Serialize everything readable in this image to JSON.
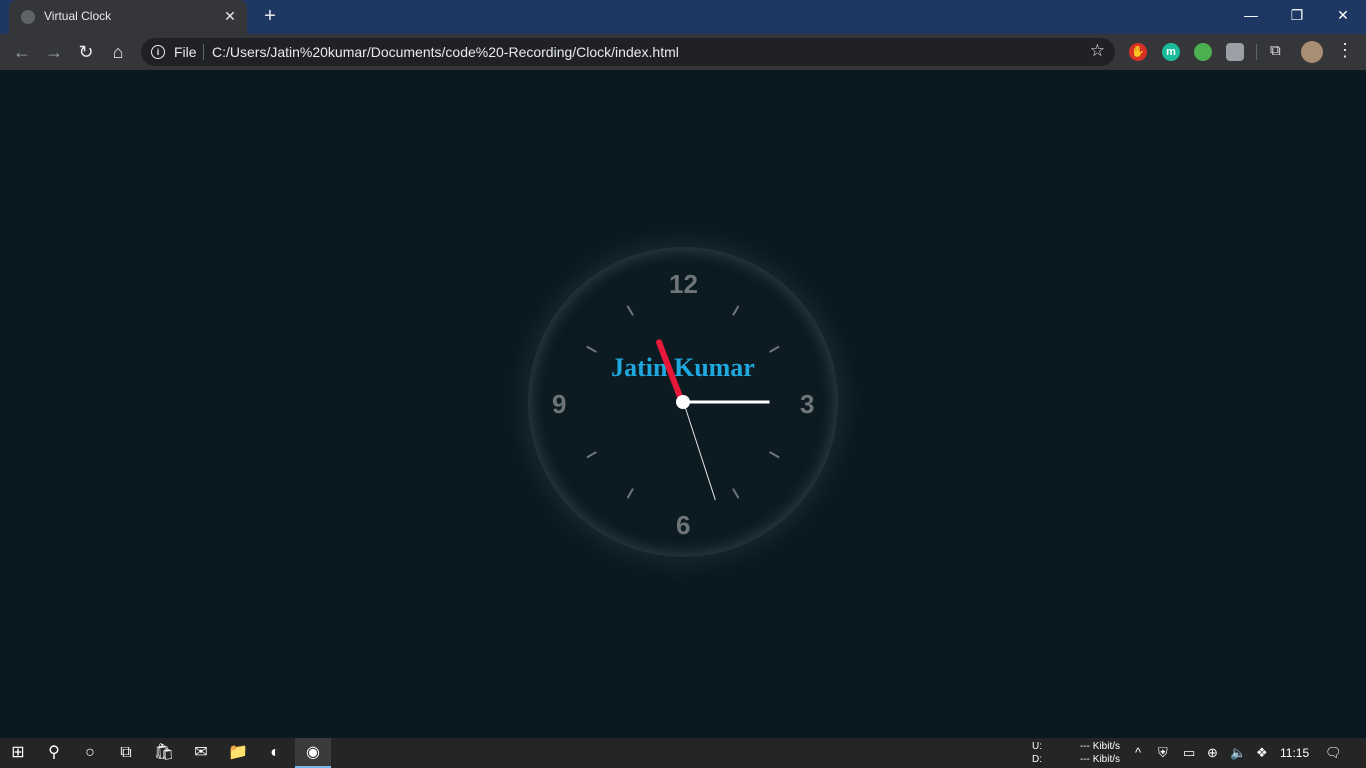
{
  "browser": {
    "tab_title": "Virtual Clock",
    "new_tab_label": "+",
    "url_scheme_label": "File",
    "url": "C:/Users/Jatin%20kumar/Documents/code%20-Recording/Clock/index.html"
  },
  "page": {
    "brand_name": "Jatin Kumar",
    "clock_numbers": [
      "12",
      "3",
      "6",
      "9"
    ],
    "time_shown": {
      "hour": 11,
      "minute": 15,
      "second": 27
    }
  },
  "taskbar": {
    "net_up_label": "U:",
    "net_down_label": "D:",
    "net_up_value": "--- Kibit/s",
    "net_down_value": "--- Kibit/s",
    "time": "11:15"
  },
  "colors": {
    "background": "#0a1920",
    "brand_text": "#1fa8de",
    "hour_hand": "#e8183a",
    "minute_hand": "#ffffff",
    "second_hand": "#e6e6e6",
    "clock_numbers": "#6e7478"
  }
}
